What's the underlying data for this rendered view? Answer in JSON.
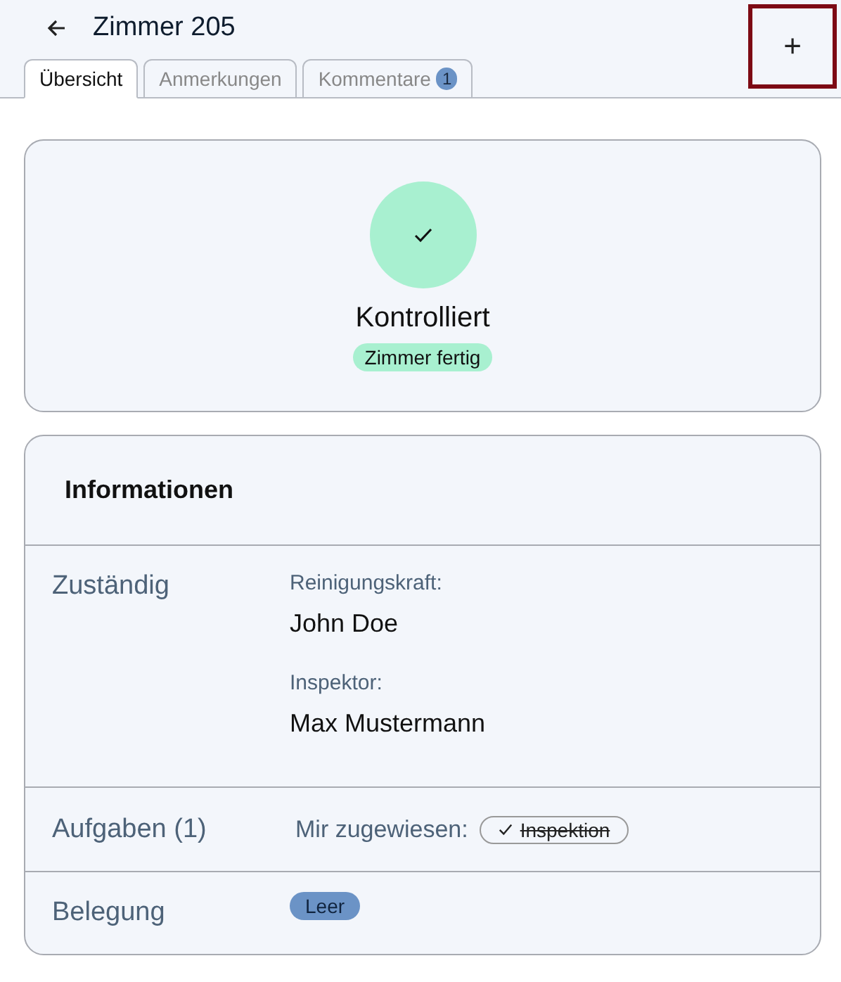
{
  "header": {
    "title": "Zimmer 205",
    "add_button": {
      "label": "+",
      "focused": true
    }
  },
  "tabs": [
    {
      "label": "Übersicht",
      "selected": true
    },
    {
      "label": "Anmerkungen",
      "selected": false
    },
    {
      "label": "Kommentare",
      "selected": false,
      "badge": "1"
    }
  ],
  "status": {
    "checked": true,
    "title": "Kontrolliert",
    "chip": "Zimmer fertig"
  },
  "info": {
    "title": "Informationen",
    "assigned": {
      "label": "Zuständig",
      "people": [
        {
          "role": "Reinigungskraft:",
          "name": "John Doe"
        },
        {
          "role": "Inspektor:",
          "name": "Max Mustermann"
        }
      ]
    },
    "tasks": {
      "label": "Aufgaben (1)",
      "prefix": "Mir zugewiesen:",
      "items": [
        {
          "label": "Inspektion",
          "done": true
        }
      ]
    },
    "occupancy": {
      "label": "Belegung",
      "chip": "Leer"
    }
  }
}
